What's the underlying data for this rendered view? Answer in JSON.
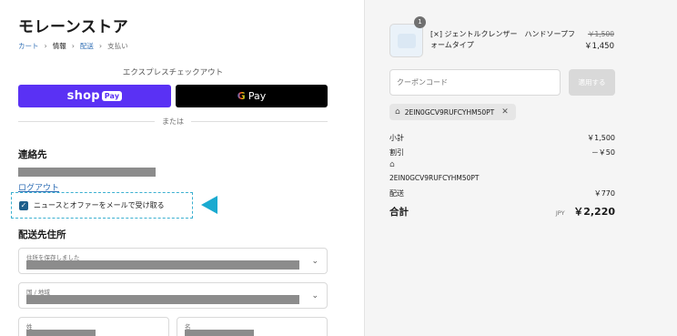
{
  "store": {
    "name": "モレーンストア"
  },
  "breadcrumb": [
    {
      "label": "カート"
    },
    {
      "label": "情報"
    },
    {
      "label": "配送"
    },
    {
      "label": "支払い"
    }
  ],
  "express": {
    "title": "エクスプレスチェックアウト",
    "shop_pay_label": "shop",
    "shop_pay_badge": "Pay",
    "gpay_g": "G",
    "gpay_label": "Pay",
    "or": "または"
  },
  "contact": {
    "heading": "連絡先",
    "logout": "ログアウト",
    "newsletter": "ニュースとオファーをメールで受け取る",
    "newsletter_checked": true
  },
  "shipping": {
    "heading": "配送先住所",
    "saved_address_label": "住所を保存しました",
    "country_label": "国 / 地域",
    "last_name_label": "姓",
    "first_name_label": "名"
  },
  "order": {
    "quantity": "1",
    "product_name": "[×] ジェントルクレンザー　ハンドソープフォームタイプ",
    "price_old": "￥1,500",
    "price": "￥1,450",
    "coupon_placeholder": "クーポンコード",
    "apply_label": "適用する",
    "applied_code": "2EIN0GCV9RUFCYHM50PT"
  },
  "summary": {
    "subtotal_label": "小計",
    "subtotal_value": "￥1,500",
    "discount_label": "割引",
    "discount_value": "－￥50",
    "discount_code": "2EIN0GCV9RUFCYHM50PT",
    "shipping_label": "配送",
    "shipping_value": "￥770",
    "total_label": "合計",
    "currency": "JPY",
    "total_value": "￥2,220"
  },
  "colors": {
    "shop_pay": "#5a31f4",
    "gpay": "#000000",
    "link": "#2f6eb5",
    "highlight": "#1aaad0"
  }
}
